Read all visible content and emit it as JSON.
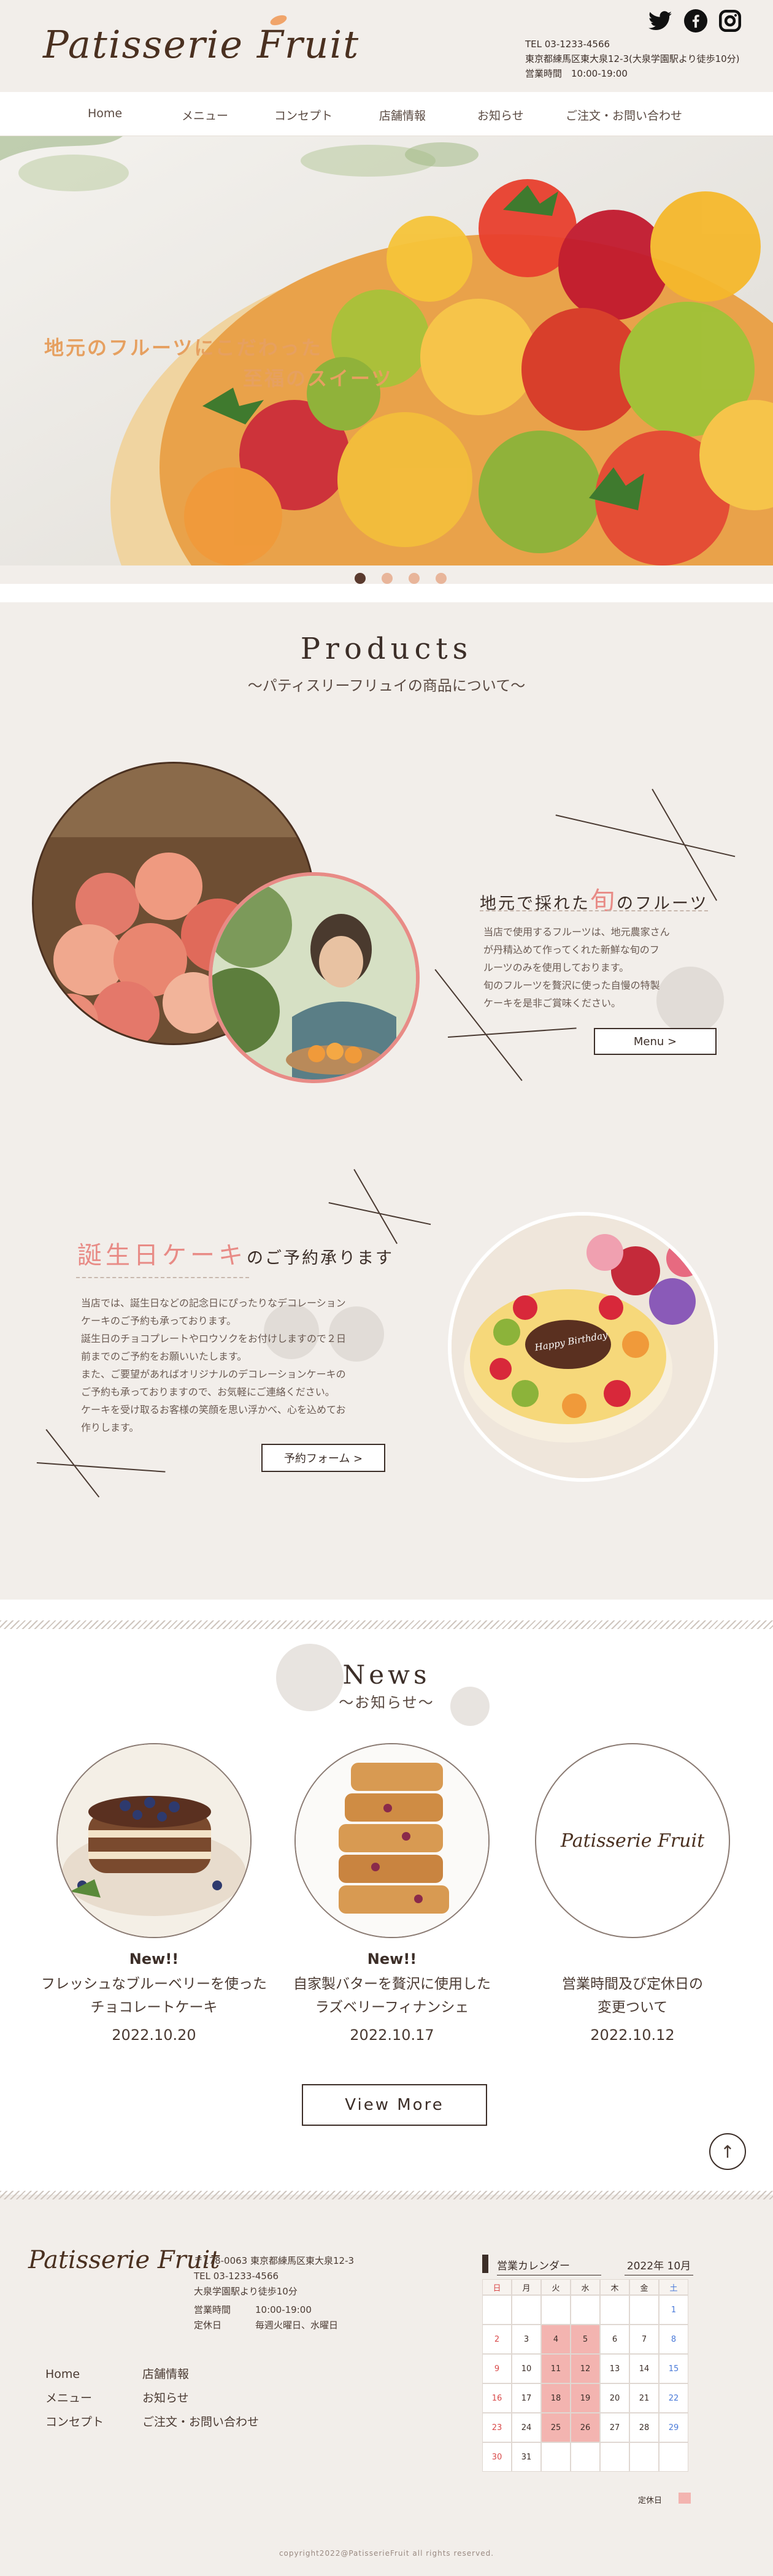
{
  "brand": {
    "logo_text": "Patisserie Fruit",
    "accent_color": "#e88b86",
    "brown": "#4a3020"
  },
  "header": {
    "tel": "TEL 03-1233-4566",
    "address": "東京都練馬区東大泉12-3(大泉学園駅より徒歩10分)",
    "hours": "営業時間　10:00-19:00",
    "social_icons": [
      "twitter-icon",
      "facebook-icon",
      "instagram-icon"
    ]
  },
  "nav": {
    "items": [
      "Home",
      "メニュー",
      "コンセプト",
      "店舗情報",
      "お知らせ",
      "ご注文・お問い合わせ"
    ]
  },
  "hero": {
    "line1": "地元のフルーツにこだわった",
    "line2": "至福のスイーツ",
    "slide_count": 4,
    "active_slide": 1
  },
  "products": {
    "title": "Products",
    "subtitle": "〜パティスリーフリュイの商品について〜",
    "block1": {
      "heading_pre": "地元で採れた",
      "heading_accent": "旬",
      "heading_post": "のフルーツ",
      "body": [
        "当店で使用するフルーツは、地元農家さん",
        "が丹精込めて作ってくれた新鮮な旬のフ",
        "ルーツのみを使用しております。",
        "旬のフルーツを贅沢に使った自慢の特製",
        "ケーキを是非ご賞味ください。"
      ],
      "button": "Menu >"
    },
    "block2": {
      "heading_accent": "誕生日ケーキ",
      "heading_post": "のご予約承ります",
      "body": [
        "当店では、誕生日などの記念日にぴったりなデコレーション",
        "ケーキのご予約も承っております。",
        "誕生日のチョコプレートやロウソクをお付けしますので２日",
        "前までのご予約をお願いいたします。",
        "また、ご要望があればオリジナルのデコレーションケーキの",
        "ご予約も承っておりますので、お気軽にご連絡ください。",
        "ケーキを受け取るお客様の笑顔を思い浮かべ、心を込めてお",
        "作りします。"
      ],
      "button": "予約フォーム >",
      "plate_text": "Happy Birthday"
    }
  },
  "news": {
    "title": "News",
    "subtitle": "〜お知らせ〜",
    "items": [
      {
        "badge": "New!!",
        "title1": "フレッシュなブルーベリーを使った",
        "title2": "チョコレートケーキ",
        "date": "2022.10.20"
      },
      {
        "badge": "New!!",
        "title1": "自家製バターを贅沢に使用した",
        "title2": "ラズベリーフィナンシェ",
        "date": "2022.10.17"
      },
      {
        "badge": "",
        "title1": "営業時間及び定休日の",
        "title2": "変更ついて",
        "date": "2022.10.12"
      }
    ],
    "view_more": "View More",
    "back_to_top": "↑"
  },
  "footer": {
    "logo_text": "Patisserie Fruit",
    "postal": "〒178-0063 東京都練馬区東大泉12-3",
    "tel": "TEL 03-1233-4566",
    "access": "大泉学園駅より徒歩10分",
    "hours_label": "営業時間",
    "hours": "10:00-19:00",
    "closed_label": "定休日",
    "closed": "毎週火曜日、水曜日",
    "links_col1": [
      "Home",
      "メニュー",
      "コンセプト"
    ],
    "links_col2": [
      "店舗情報",
      "お知らせ",
      "ご注文・お問い合わせ"
    ],
    "calendar": {
      "title": "営業カレンダー",
      "month": "2022年 10月",
      "weekdays": [
        "日",
        "月",
        "火",
        "水",
        "木",
        "金",
        "土"
      ],
      "legend": "定休日"
    },
    "copyright": "copyright2022@PatisserieFruit all rights reserved."
  }
}
